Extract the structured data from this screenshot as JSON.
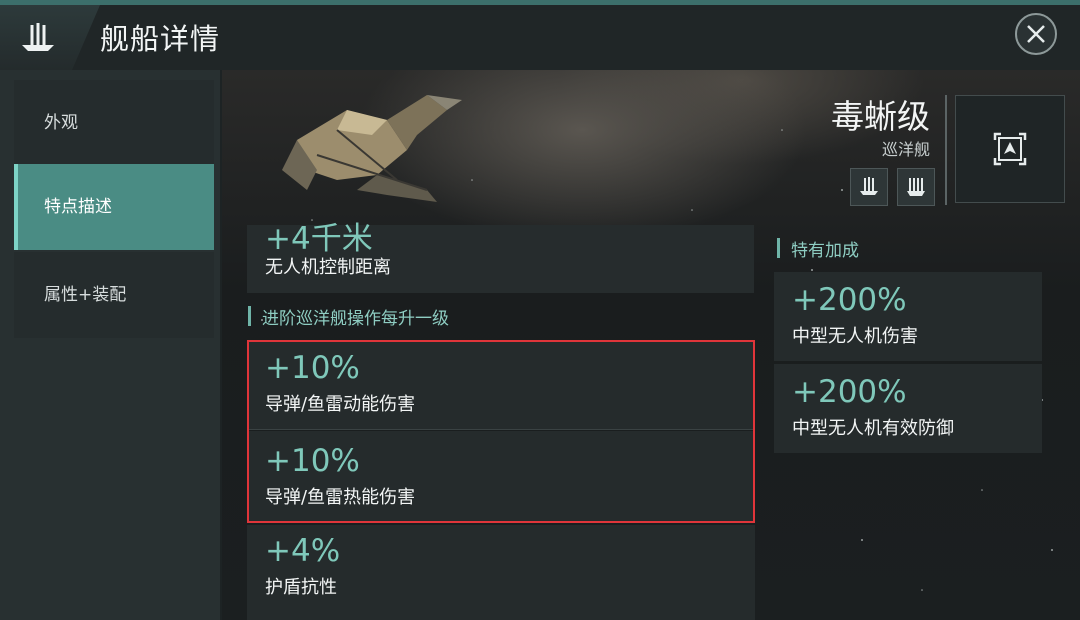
{
  "header": {
    "title": "舰船详情",
    "icon": "drone-ship-icon",
    "close_icon": "close-icon"
  },
  "sidebar": {
    "items": [
      {
        "label": "外观",
        "active": false
      },
      {
        "label": "特点描述",
        "active": true
      },
      {
        "label": "属性+装配",
        "active": false
      }
    ]
  },
  "ship": {
    "name": "毒蜥级",
    "class": "巡洋舰",
    "badges": [
      "drone-bay-icon",
      "turret-icon"
    ],
    "emblem": "navigation-target-icon"
  },
  "left_column": {
    "top_card": {
      "value": "+4千米",
      "label": "无人机控制距离"
    },
    "section_title": "进阶巡洋舰操作每升一级",
    "bonuses": [
      {
        "value": "+10%",
        "label": "导弹/鱼雷动能伤害"
      },
      {
        "value": "+10%",
        "label": "导弹/鱼雷热能伤害"
      },
      {
        "value": "+4%",
        "label": "护盾抗性"
      }
    ]
  },
  "right_column": {
    "section_title": "特有加成",
    "bonuses": [
      {
        "value": "+200%",
        "label": "中型无人机伤害"
      },
      {
        "value": "+200%",
        "label": "中型无人机有效防御"
      }
    ]
  },
  "colors": {
    "accent": "#4a8c84",
    "value_text": "#7fc8ba",
    "highlight_border": "#e0353a"
  }
}
